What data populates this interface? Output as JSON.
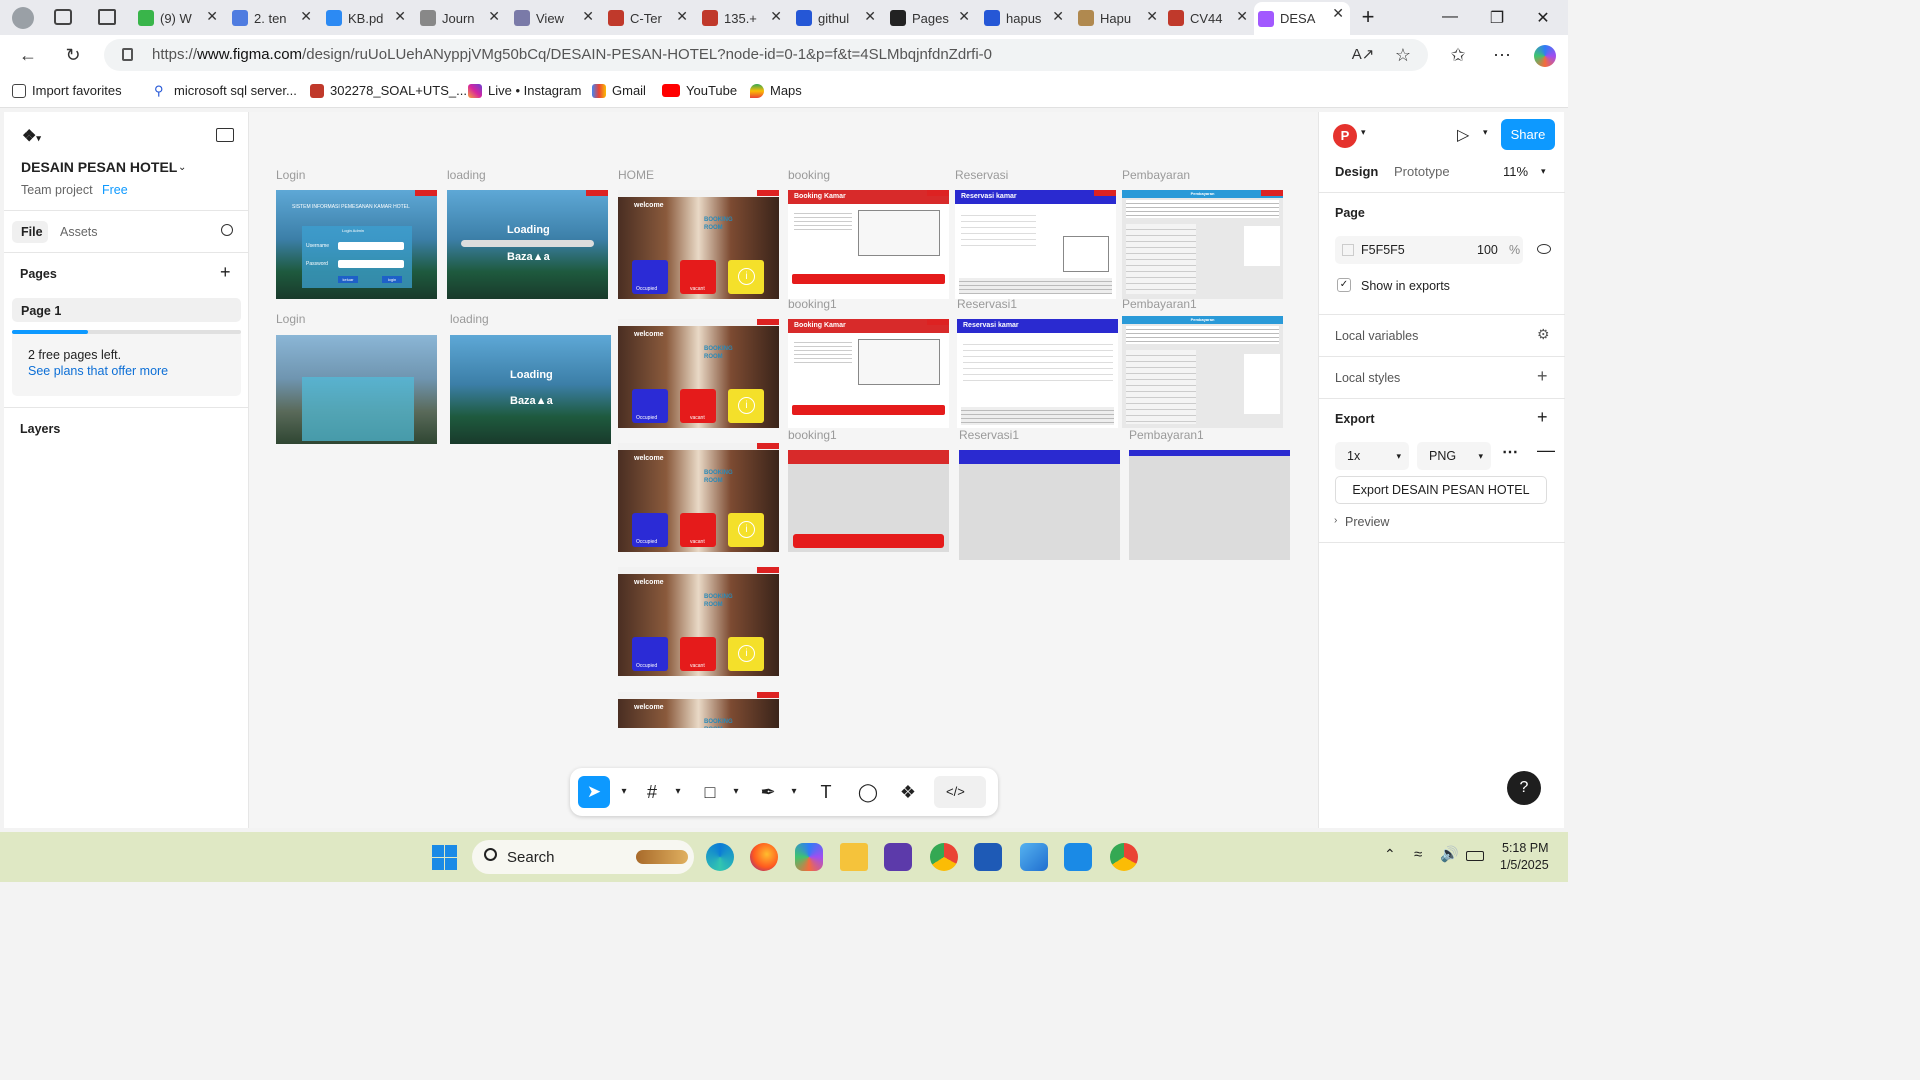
{
  "browser": {
    "tabs": [
      {
        "label": "(9) W",
        "color": "#39b54a"
      },
      {
        "label": "2. ten",
        "color": "#4f7ce0"
      },
      {
        "label": "KB.pd",
        "color": "#2c8af3"
      },
      {
        "label": "Journ",
        "color": "#888888"
      },
      {
        "label": "View",
        "color": "#7a7aa8"
      },
      {
        "label": "C-Ter",
        "color": "#c0392b"
      },
      {
        "label": "135.+",
        "color": "#c0392b"
      },
      {
        "label": "githul",
        "color": "#2557d6"
      },
      {
        "label": "Pages",
        "color": "#222222"
      },
      {
        "label": "hapus",
        "color": "#2557d6"
      },
      {
        "label": "Hapu",
        "color": "#b0894f"
      },
      {
        "label": "CV44",
        "color": "#c0392b"
      },
      {
        "label": "DESA",
        "color": "#a259ff"
      }
    ],
    "url_prefix": "https://",
    "url_domain": "www.figma.com",
    "url_path": "/design/ruUoLUehANyppjVMg50bCq/DESAIN-PESAN-HOTEL?node-id=0-1&p=f&t=4SLMbqjnfdnZdrfi-0",
    "bookmarks": [
      "Import favorites",
      "microsoft sql server...",
      "302278_SOAL+UTS_...",
      "Live • Instagram",
      "Gmail",
      "YouTube",
      "Maps"
    ]
  },
  "left_panel": {
    "file_name": "DESAIN PESAN HOTEL",
    "team": "Team project",
    "plan": "Free",
    "tab_file": "File",
    "tab_assets": "Assets",
    "pages_title": "Pages",
    "page1": "Page 1",
    "free_pages": "2 free pages left.",
    "plans_link": "See plans that offer more",
    "layers_title": "Layers"
  },
  "canvas": {
    "labels": {
      "login": "Login",
      "loading": "loading",
      "home": "HOME",
      "booking": "booking",
      "reservasi": "Reservasi",
      "pembayaran": "Pembayaran",
      "login2": "Login",
      "loading2": "loading",
      "booking1": "booking1",
      "reservasi1": "Reservasi1",
      "pembayaran1": "Pembayaran1",
      "booking1b": "booking1",
      "reservasi1b": "Reservasi1",
      "pembayaran1b": "Pembayaran1"
    },
    "login_title": "SISTEM INFORMASI PEMESANAN KAMAR HOTEL",
    "login_sub": "Login Admin",
    "username": "Username",
    "password": "Password",
    "keluar": "keluar",
    "login_btn": "login",
    "loading_text": "Loading",
    "brand": "Baza▲a",
    "welcome": "welcome",
    "booking_room": "BOOKING ROOM",
    "occupied": "Occupied",
    "vacant": "vacant",
    "booking_kamar": "Booking Kamar",
    "reservasi_kamar": "Reservasi kamar",
    "pembayaran_title": "Pembayaran"
  },
  "toolbar": {
    "icons": [
      "move-icon",
      "frame-icon",
      "rectangle-icon",
      "pen-icon",
      "text-icon",
      "comment-icon",
      "actions-icon",
      "dev-mode-icon"
    ]
  },
  "right_panel": {
    "avatar_letter": "P",
    "share": "Share",
    "tab_design": "Design",
    "tab_prototype": "Prototype",
    "zoom": "11%",
    "page_title": "Page",
    "page_color": "F5F5F5",
    "page_opacity": "100",
    "percent": "%",
    "show_exports": "Show in exports",
    "local_variables": "Local variables",
    "local_styles": "Local styles",
    "export_title": "Export",
    "export_scale": "1x",
    "export_format": "PNG",
    "export_button": "Export DESAIN PESAN HOTEL",
    "preview": "Preview",
    "help": "?"
  },
  "taskbar": {
    "search": "Search",
    "time": "5:18 PM",
    "date": "1/5/2025"
  }
}
